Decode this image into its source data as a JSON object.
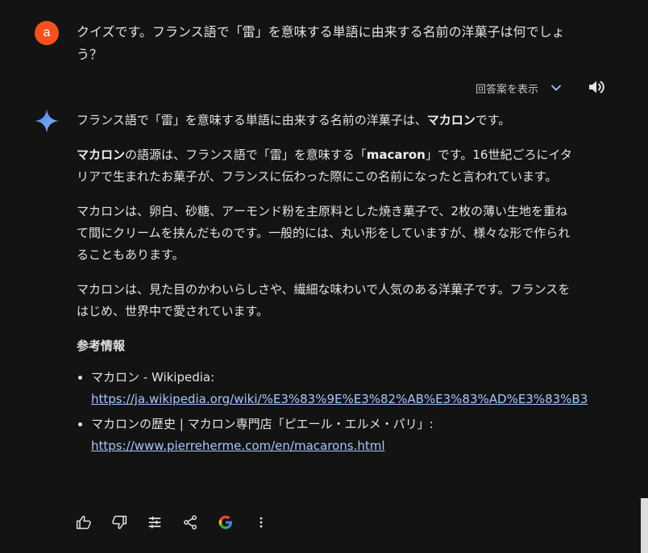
{
  "user": {
    "avatar_letter": "a",
    "message": "クイズです。フランス語で「雷」を意味する単語に由来する名前の洋菓子は何でしょう？"
  },
  "response_header": {
    "show_drafts_label": "回答案を表示",
    "drafts_icon": "chevron-down-icon",
    "speaker_icon": "speaker-icon"
  },
  "answer": {
    "p1_pre": "フランス語で「雷」を意味する単語に由来する名前の洋菓子は、",
    "p1_bold": "マカロン",
    "p1_post": "です。",
    "p2_bold1": "マカロン",
    "p2_mid": "の語源は、フランス語で「雷」を意味する「",
    "p2_bold2": "macaron",
    "p2_post": "」です。16世紀ごろにイタリアで生まれたお菓子が、フランスに伝わった際にこの名前になったと言われています。",
    "p3": "マカロンは、卵白、砂糖、アーモンド粉を主原料とした焼き菓子で、2枚の薄い生地を重ねて間にクリームを挟んだものです。一般的には、丸い形をしていますが、様々な形で作られることもあります。",
    "p4": "マカロンは、見た目のかわいらしさや、繊細な味わいで人気のある洋菓子です。フランスをはじめ、世界中で愛されています。",
    "refs_title": "参考情報",
    "refs": [
      {
        "text": "マカロン - Wikipedia: ",
        "url": "https://ja.wikipedia.org/wiki/%E3%83%9E%E3%82%AB%E3%83%AD%E3%83%B3"
      },
      {
        "text": "マカロンの歴史 | マカロン専門店「ピエール・エルメ・パリ」: ",
        "url": "https://www.pierreherme.com/en/macarons.html"
      }
    ]
  },
  "actions": [
    "thumb-up-icon",
    "thumb-down-icon",
    "tune-icon",
    "share-icon",
    "google-icon",
    "more-vert-icon"
  ],
  "colors": {
    "background": "#131314",
    "text": "#e3e3e3",
    "link": "#a8c7fa",
    "avatar": "#f4511e"
  }
}
